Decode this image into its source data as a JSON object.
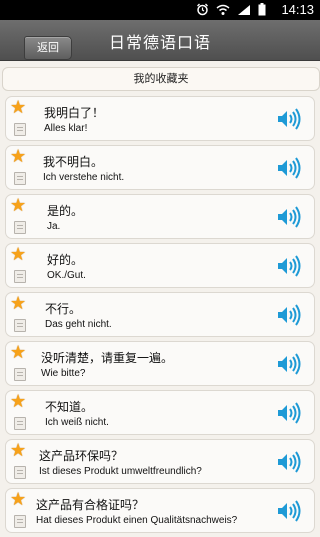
{
  "status_bar": {
    "time": "14:13"
  },
  "header": {
    "back_label": "返回",
    "title": "日常德语口语"
  },
  "section": {
    "title": "我的收藏夹"
  },
  "phrases": [
    {
      "zh": "我明白了！",
      "de": "Alles klar!"
    },
    {
      "zh": "我不明白。",
      "de": "Ich verstehe nicht."
    },
    {
      "zh": "是的。",
      "de": "Ja."
    },
    {
      "zh": "好的。",
      "de": "OK./Gut."
    },
    {
      "zh": "不行。",
      "de": "Das geht nicht."
    },
    {
      "zh": "没听清楚，请重复一遍。",
      "de": "Wie bitte?"
    },
    {
      "zh": "不知道。",
      "de": "Ich weiß nicht."
    },
    {
      "zh": "这产品环保吗？",
      "de": "Ist dieses Produkt umweltfreundlich?"
    },
    {
      "zh": "这产品有合格证吗？",
      "de": "Hat dieses Produkt einen Qualitätsnachweis?"
    }
  ],
  "icons": {
    "favorite": "star-icon",
    "note": "book-icon",
    "play": "speaker-icon"
  },
  "colors": {
    "star": "#f7a21a",
    "speaker": "#1e9ad6",
    "titlebar": "#5a5a5a"
  }
}
